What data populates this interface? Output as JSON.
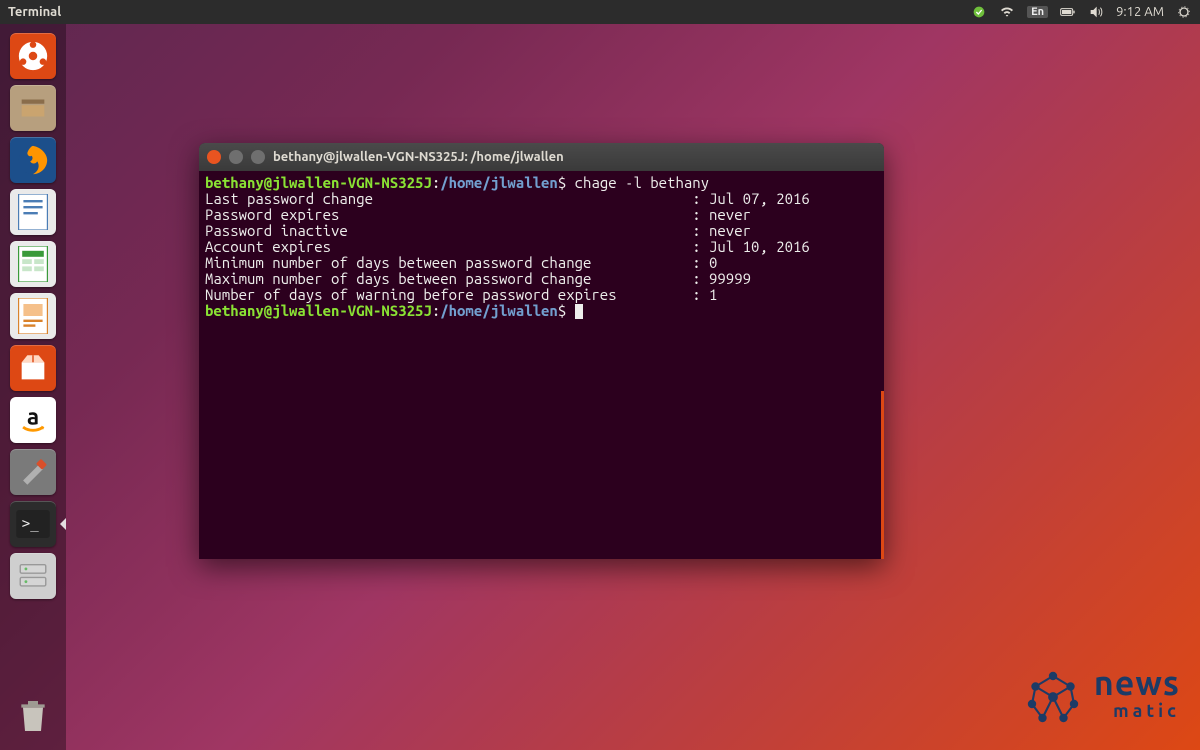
{
  "menubar": {
    "app_label": "Terminal",
    "language": "En",
    "time": "9:12 AM"
  },
  "launcher": {
    "items": [
      {
        "name": "dash",
        "color": "#dd4814"
      },
      {
        "name": "files",
        "color": "#b79f7e"
      },
      {
        "name": "firefox",
        "color": "#1c4f8b"
      },
      {
        "name": "writer",
        "color": "#eaeaea"
      },
      {
        "name": "calc",
        "color": "#eaeaea"
      },
      {
        "name": "impress",
        "color": "#eaeaea"
      },
      {
        "name": "software",
        "color": "#dd4814"
      },
      {
        "name": "amazon",
        "color": "#ffffff"
      },
      {
        "name": "settings",
        "color": "#7a7a7a"
      },
      {
        "name": "terminal",
        "color": "#2c2c2c",
        "active": true
      },
      {
        "name": "servers",
        "color": "#cfcfcf"
      }
    ]
  },
  "terminal": {
    "title": "bethany@jlwallen-VGN-NS325J: /home/jlwallen",
    "prompt": {
      "user_host": "bethany@jlwallen-VGN-NS325J",
      "path": "/home/jlwallen",
      "sigil": "$"
    },
    "command": "chage -l bethany",
    "output_rows": [
      {
        "label": "Last password change",
        "value": "Jul 07, 2016"
      },
      {
        "label": "Password expires",
        "value": "never"
      },
      {
        "label": "Password inactive",
        "value": "never"
      },
      {
        "label": "Account expires",
        "value": "Jul 10, 2016"
      },
      {
        "label": "Minimum number of days between password change",
        "value": "0"
      },
      {
        "label": "Maximum number of days between password change",
        "value": "99999"
      },
      {
        "label": "Number of days of warning before password expires",
        "value": "1"
      }
    ]
  },
  "watermark": {
    "brand_top": "news",
    "brand_bottom": "matic"
  }
}
